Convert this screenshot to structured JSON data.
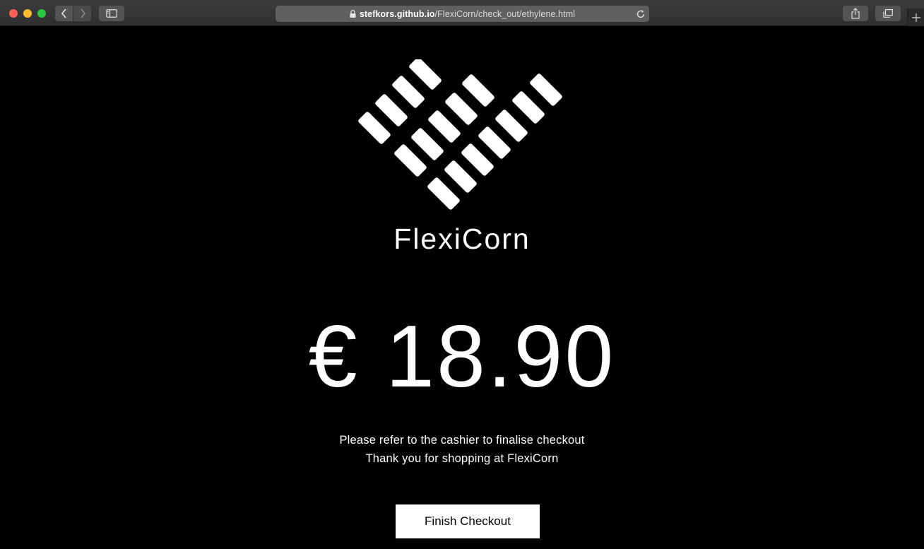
{
  "browser": {
    "url_host": "stefkors.github.io",
    "url_path": "/FlexiCorn/check_out/ethylene.html"
  },
  "page": {
    "brand_name": "FlexiCorn",
    "price": "€ 18.90",
    "message_line1": "Please refer to the cashier to finalise checkout",
    "message_line2": "Thank you for shopping at FlexiCorn",
    "finish_button_label": "Finish Checkout"
  },
  "colors": {
    "background": "#000000",
    "foreground": "#ffffff"
  }
}
